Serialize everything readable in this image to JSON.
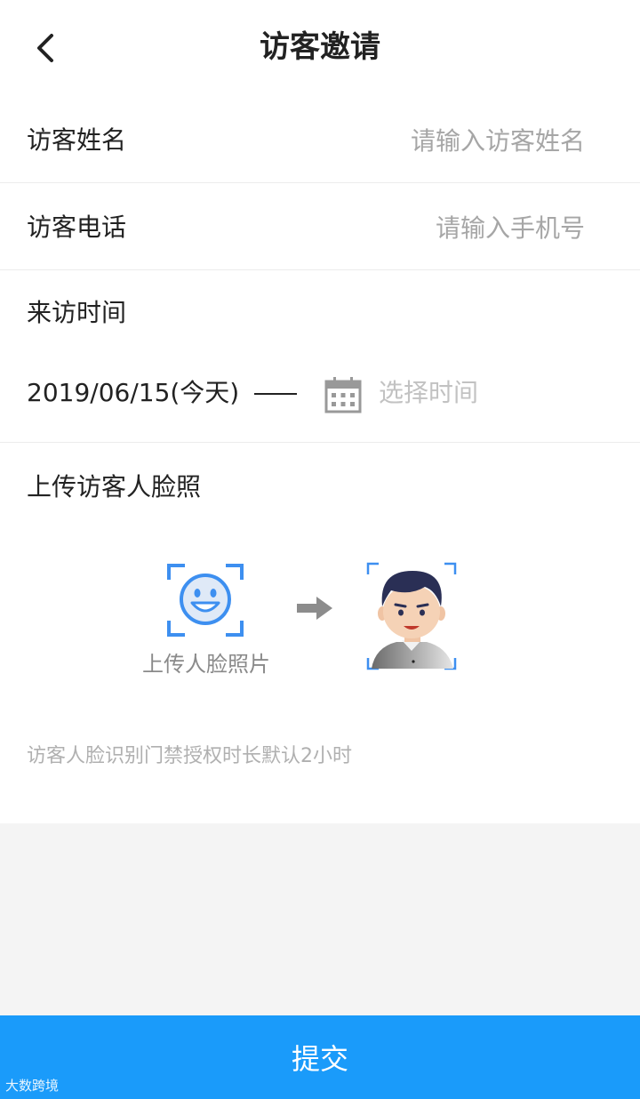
{
  "header": {
    "title": "访客邀请",
    "back_icon": "chevron-left-icon"
  },
  "form": {
    "name": {
      "label": "访客姓名",
      "placeholder": "请输入访客姓名",
      "value": ""
    },
    "phone": {
      "label": "访客电话",
      "placeholder": "请输入手机号",
      "value": ""
    },
    "visit_time": {
      "label": "来访时间",
      "start": "2019/06/15(今天)",
      "end_placeholder": "选择时间",
      "calendar_icon": "calendar-icon"
    },
    "face": {
      "label": "上传访客人脸照",
      "upload_caption": "上传人脸照片",
      "upload_icon": "smiley-face-scan-icon",
      "arrow_icon": "arrow-right-icon",
      "sample_icon": "sample-face-avatar-icon"
    },
    "hint": "访客人脸识别门禁授权时长默认2小时"
  },
  "submit_label": "提交",
  "watermark": "大数跨境",
  "colors": {
    "accent": "#1a9bfa",
    "icon_blue": "#3d8ff0",
    "placeholder": "#a6a6a6",
    "background": "#f4f4f4"
  }
}
